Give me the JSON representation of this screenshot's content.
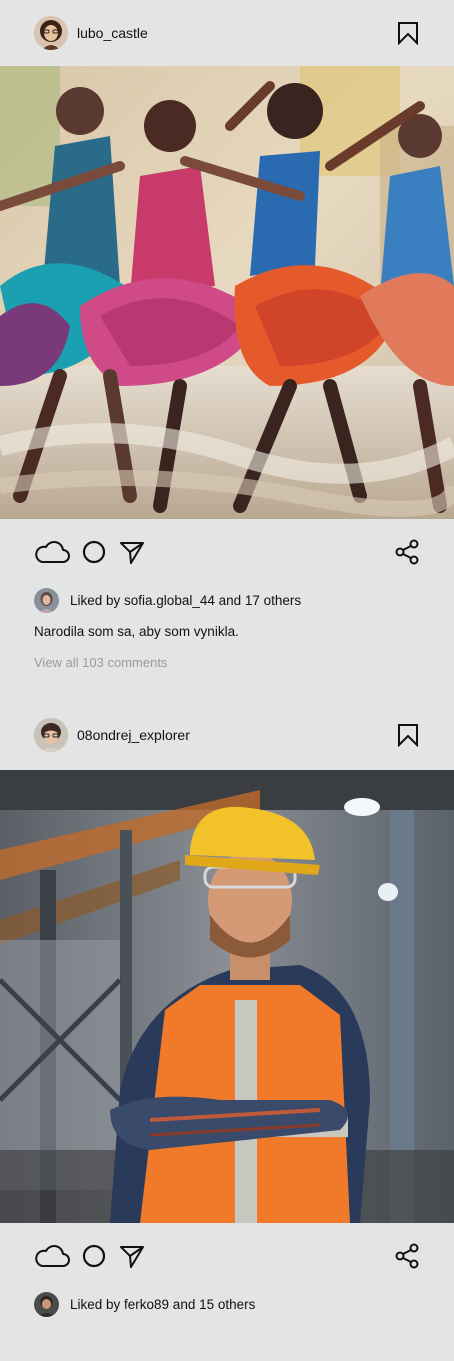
{
  "posts": [
    {
      "username": "lubo_castle",
      "likes_text": "Liked by sofia.global_44 and 17 others",
      "caption": "Narodila som sa, aby som vynikla.",
      "comments_link": "View all 103 comments"
    },
    {
      "username": "08ondrej_explorer",
      "likes_text": "Liked by ferko89 and 15 others"
    }
  ]
}
